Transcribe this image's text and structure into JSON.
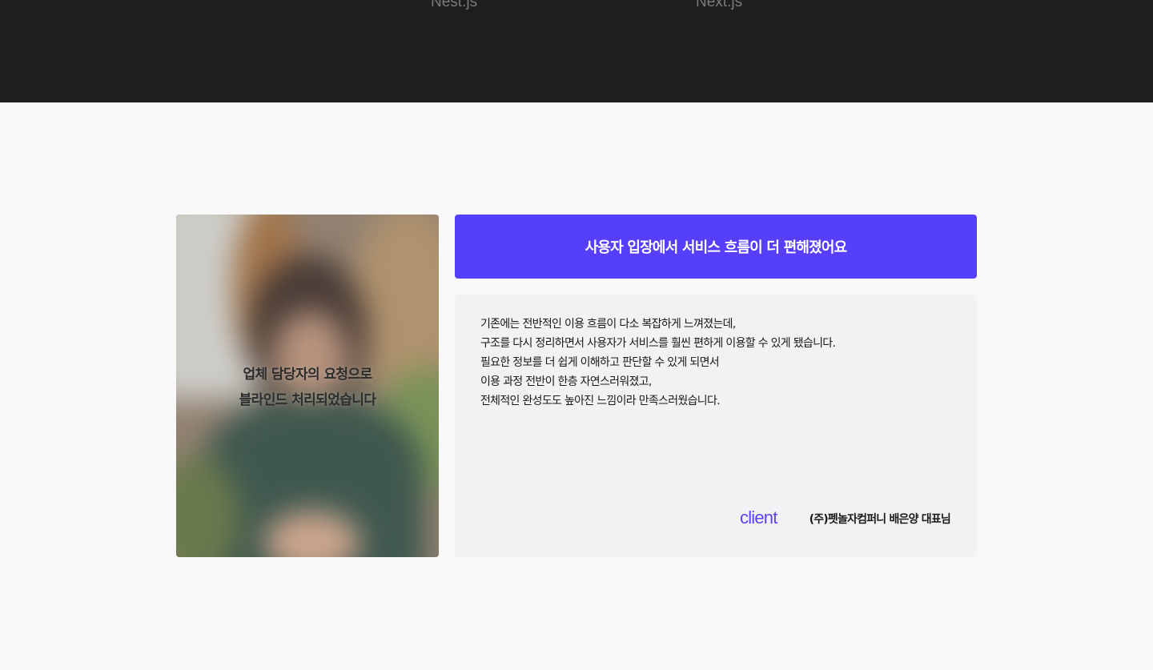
{
  "tech_stack": {
    "items": [
      "Nest.js",
      "Next.js"
    ]
  },
  "review": {
    "photo_blind_lines": [
      "업체 담당자의 요청으로",
      "블라인드 처리되었습니다"
    ],
    "headline": "사용자 입장에서 서비스 흐름이 더 편해졌어요",
    "body_lines": [
      "기존에는 전반적인 이용 흐름이 다소 복잡하게 느껴졌는데,",
      "구조를 다시 정리하면서 사용자가 서비스를 훨씬 편하게 이용할 수 있게 됐습니다.",
      "필요한 정보를 더 쉽게 이해하고 판단할 수 있게 되면서",
      "이용 과정 전반이 한층 자연스러워졌고,",
      "전체적인 완성도도 높아진 느낌이라 만족스러웠습니다."
    ],
    "client_tag": "client",
    "client_name": "(주)펫놀자컴퍼니 배은양 대표님"
  },
  "colors": {
    "accent": "#553ffa",
    "top_band": "#1e1e1e",
    "page_bg": "#f8f8f8",
    "review_bg": "#f2f2f4"
  }
}
